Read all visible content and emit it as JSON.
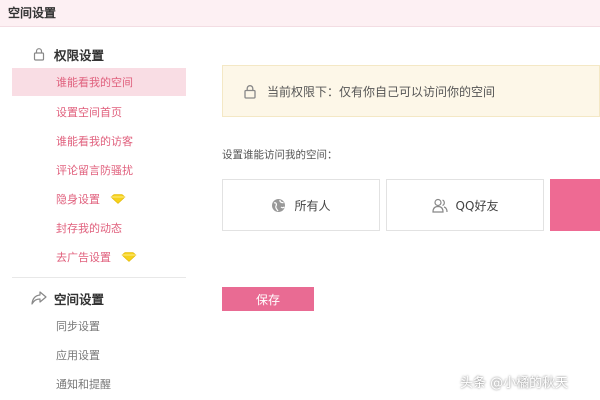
{
  "header": {
    "title": "空间设置"
  },
  "sidebar": {
    "groups": [
      {
        "title": "权限设置",
        "icon": "lock-icon",
        "items": [
          {
            "label": "谁能看我的空间",
            "active": true
          },
          {
            "label": "设置空间首页"
          },
          {
            "label": "谁能看我的访客"
          },
          {
            "label": "评论留言防骚扰"
          },
          {
            "label": "隐身设置",
            "badge": "diamond-icon"
          },
          {
            "label": "封存我的动态"
          },
          {
            "label": "去广告设置",
            "badge": "diamond-icon"
          }
        ]
      },
      {
        "title": "空间设置",
        "icon": "share-icon",
        "items": [
          {
            "label": "同步设置"
          },
          {
            "label": "应用设置"
          },
          {
            "label": "通知和提醒"
          }
        ]
      }
    ]
  },
  "main": {
    "notice": "当前权限下：仅有你自己可以访问你的空间",
    "prompt": "设置谁能访问我的空间：",
    "options": [
      {
        "label": "所有人",
        "icon": "globe-icon"
      },
      {
        "label": "QQ好友",
        "icon": "friends-icon"
      },
      {
        "label": "",
        "selected": true
      }
    ],
    "save_label": "保存"
  },
  "watermark": "头条 @小橘的秋天",
  "colors": {
    "accent": "#e96b93",
    "active_bg": "#f9dde4",
    "notice_bg": "#fdf7e8"
  }
}
